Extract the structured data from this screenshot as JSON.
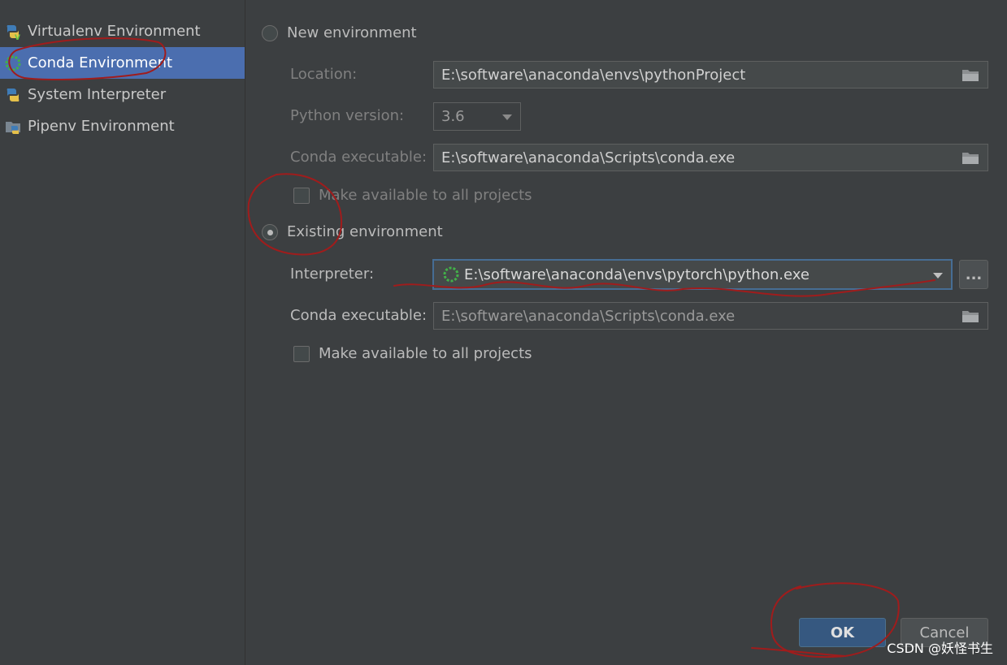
{
  "sidebar": {
    "items": [
      {
        "label": "Virtualenv Environment",
        "icon": "python-virtualenv-icon"
      },
      {
        "label": "Conda Environment",
        "icon": "conda-icon",
        "selected": true
      },
      {
        "label": "System Interpreter",
        "icon": "python-icon"
      },
      {
        "label": "Pipenv Environment",
        "icon": "pipenv-icon"
      }
    ]
  },
  "new_env": {
    "radio_label": "New environment",
    "location_label": "Location:",
    "location_value": "E:\\software\\anaconda\\envs\\pythonProject",
    "python_version_label": "Python version:",
    "python_version_value": "3.6",
    "conda_exec_label": "Conda executable:",
    "conda_exec_value": "E:\\software\\anaconda\\Scripts\\conda.exe",
    "make_available_label": "Make available to all projects"
  },
  "existing_env": {
    "radio_label": "Existing environment",
    "interpreter_label": "Interpreter:",
    "interpreter_value": "E:\\software\\anaconda\\envs\\pytorch\\python.exe",
    "browse_label": "...",
    "conda_exec_label": "Conda executable:",
    "conda_exec_value": "E:\\software\\anaconda\\Scripts\\conda.exe",
    "make_available_label": "Make available to all projects"
  },
  "buttons": {
    "ok_label": "OK",
    "cancel_label": "Cancel"
  },
  "watermark": "CSDN @妖怪书生",
  "colors": {
    "background": "#3c3f41",
    "selection": "#4b6eaf",
    "ok_button": "#365880",
    "focus_border": "#466d94",
    "annotation": "#a01c1c"
  }
}
